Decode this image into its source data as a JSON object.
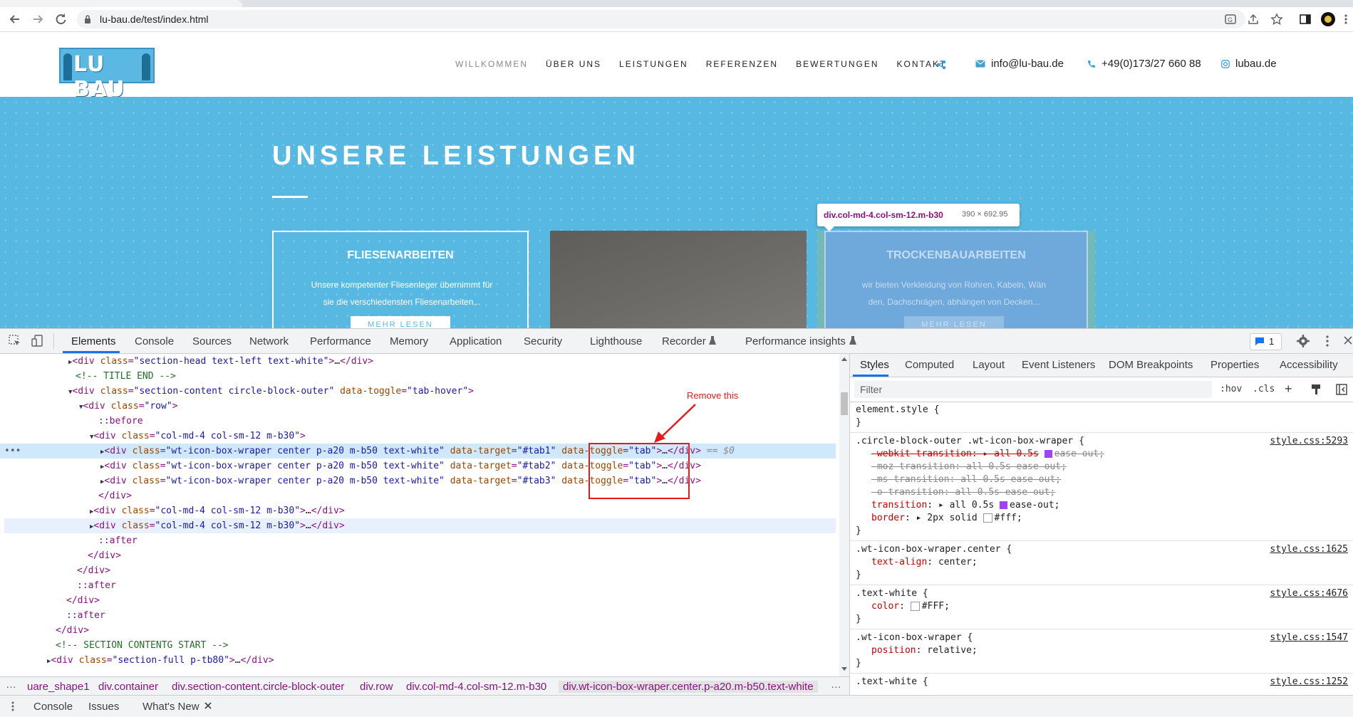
{
  "browser": {
    "url": "lu-bau.de/test/index.html"
  },
  "site": {
    "logo_text": "LU BAU",
    "nav": [
      "WILLKOMMEN",
      "ÜBER UNS",
      "LEISTUNGEN",
      "REFERENZEN",
      "BEWERTUNGEN",
      "KONTAKT"
    ],
    "email": "info@lu-bau.de",
    "phone": "+49(0)173/27 660 88",
    "instagram": "lubau.de",
    "hero_title": "UNSERE LEISTUNGEN",
    "card1": {
      "title": "FLIESENARBEITEN",
      "line1": "Unsere kompetenter Fliesenleger übernimmt für",
      "line2": "sie die verschiedensten Fliesenarbeiten...",
      "button": "MEHR LESEN"
    },
    "card3": {
      "title": "TROCKENBAUARBEITEN",
      "line1": "wir bieten Verkleidung von Rohren, Kabeln, Wän",
      "line2": "den, Dachschrägen, abhängen von Decken...",
      "button": "MEHR LESEN"
    },
    "tooltip": {
      "name": "div.col-md-4.col-sm-12.m-b30",
      "dims": "390 × 692.95"
    }
  },
  "devtools": {
    "tabs": [
      "Elements",
      "Console",
      "Sources",
      "Network",
      "Performance",
      "Memory",
      "Application",
      "Security",
      "Lighthouse",
      "Recorder",
      "Performance insights"
    ],
    "issues_count": "1",
    "annotation": "Remove this",
    "dom": {
      "l1": {
        "tag": "div",
        "attr": "class",
        "val": "\"section-head text-left text-white\""
      },
      "l2": "<!-- TITLE END -->",
      "l3": {
        "tag": "div",
        "attr1": "class",
        "val1": "\"section-content circle-block-outer\"",
        "attr2": "data-toggle",
        "val2": "\"tab-hover\""
      },
      "l4": {
        "tag": "div",
        "attr": "class",
        "val": "\"row\""
      },
      "l5": "::before",
      "l6": {
        "tag": "div",
        "attr": "class",
        "val": "\"col-md-4 col-sm-12 m-b30\""
      },
      "l7": {
        "val": "\"wt-icon-box-wraper center p-a20 m-b50 text-white\"",
        "target": "\"#tab1\"",
        "toggle": "\"tab\"",
        "eq": "== $0"
      },
      "l8": {
        "val": "\"wt-icon-box-wraper center p-a20 m-b50 text-white\"",
        "target": "\"#tab2\"",
        "toggle": "\"tab\""
      },
      "l9": {
        "val": "\"wt-icon-box-wraper center p-a20 m-b50 text-white\"",
        "target": "\"#tab3\"",
        "toggle": "\"tab\""
      },
      "l11": {
        "val": "\"col-md-4 col-sm-12 m-b30\""
      },
      "l12": {
        "val": "\"col-md-4 col-sm-12 m-b30\""
      },
      "after": "::after",
      "comment2": "<!-- SECTION CONTENTG START -->",
      "l20": {
        "val": "\"section-full p-tb80\""
      }
    },
    "breadcrumbs": [
      "uare_shape1",
      "div.container",
      "div.section-content.circle-block-outer",
      "div.row",
      "div.col-md-4.col-sm-12.m-b30",
      "div.wt-icon-box-wraper.center.p-a20.m-b50.text-white"
    ],
    "drawer_tabs": [
      "Console",
      "Issues",
      "What's New"
    ],
    "styles_tabs": [
      "Styles",
      "Computed",
      "Layout",
      "Event Listeners",
      "DOM Breakpoints",
      "Properties",
      "Accessibility"
    ],
    "filter_placeholder": "Filter",
    "hov": ":hov",
    "cls": ".cls",
    "rules": {
      "r0": {
        "selector": "element.style {"
      },
      "r1": {
        "selector": ".circle-block-outer .wt-icon-box-wraper {",
        "source": "style.css:5293",
        "p1": "-webkit-transition: ▸ all 0.5s",
        "p1b": "ease-out;",
        "p2": "-moz-transition: all 0.5s ease-out;",
        "p3": "-ms-transition: all 0.5s ease-out;",
        "p4": "-o-transition: all 0.5s ease-out;",
        "p5n": "transition",
        "p5v": "▸ all 0.5s",
        "p5b": "ease-out;",
        "p6n": "border",
        "p6v": "▸ 2px solid",
        "p6c": "#fff;"
      },
      "r2": {
        "selector": ".wt-icon-box-wraper.center {",
        "source": "style.css:1625",
        "pn": "text-align",
        "pv": "center;"
      },
      "r3": {
        "selector": ".text-white {",
        "source": "style.css:4676",
        "pn": "color",
        "pv": "#FFF;"
      },
      "r4": {
        "selector": ".wt-icon-box-wraper {",
        "source": "style.css:1547",
        "pn": "position",
        "pv": "relative;"
      },
      "r5": {
        "selector": ".text-white {",
        "source": "style.css:1252"
      }
    }
  },
  "colors": {
    "hero_bg": "#57b9e2",
    "accent": "#1a73e8",
    "annotation_red": "#e31b1b"
  }
}
